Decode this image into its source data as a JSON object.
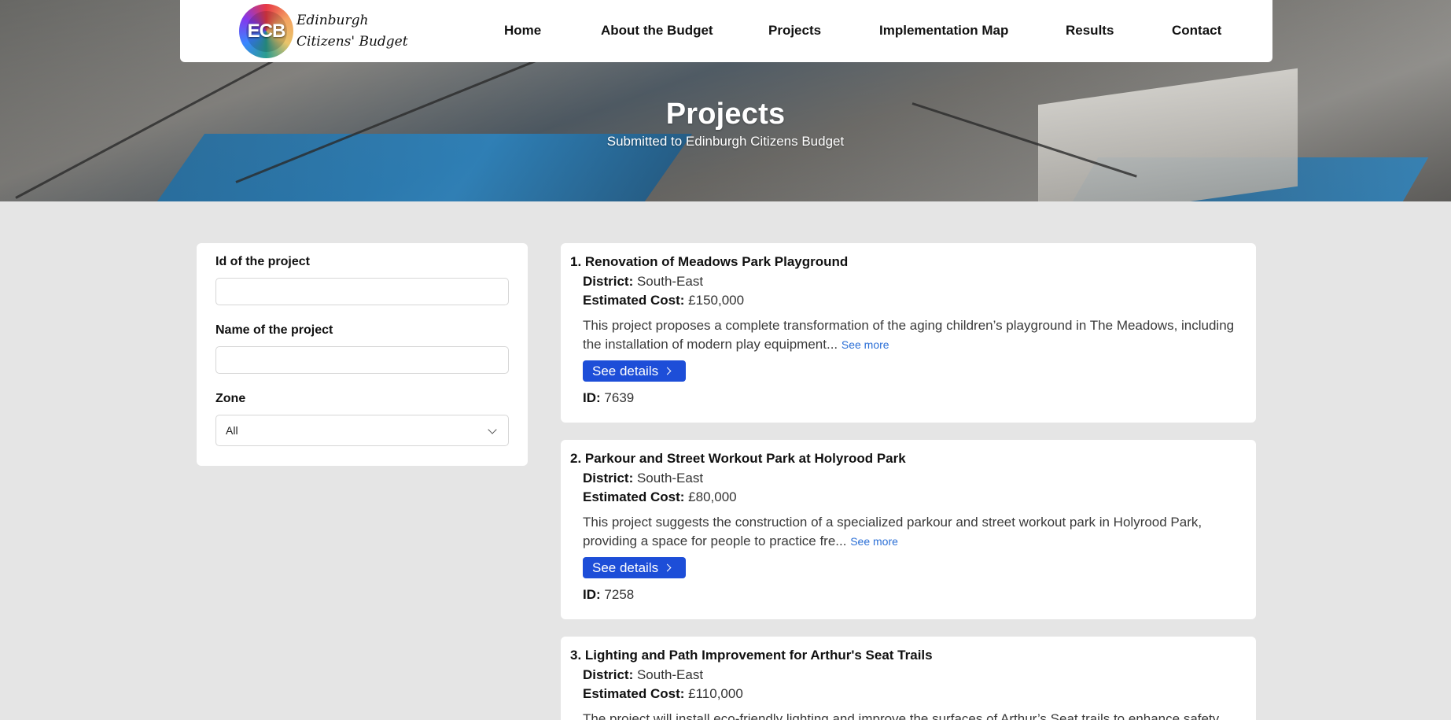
{
  "logo": {
    "initials": "ECB",
    "line1": "Edinburgh",
    "line2": "Citizens' Budget"
  },
  "nav": {
    "items": [
      "Home",
      "About the Budget",
      "Projects",
      "Implementation Map",
      "Results",
      "Contact"
    ]
  },
  "hero": {
    "title": "Projects",
    "subtitle": "Submitted to Edinburgh Citizens Budget"
  },
  "filters": {
    "id_label": "Id of the project",
    "id_value": "",
    "name_label": "Name of the project",
    "name_value": "",
    "zone_label": "Zone",
    "zone_selected": "All"
  },
  "projects": [
    {
      "title": "1. Renovation of Meadows Park Playground",
      "district_label": "District:",
      "district": "South-East",
      "cost_label": "Estimated Cost:",
      "cost": "£150,000",
      "description": "This project proposes a complete transformation of the aging children’s playground in The Meadows, including the installation of modern play equipment...",
      "see_more": "See more",
      "button": "See details",
      "id_label": "ID:",
      "id": "7639"
    },
    {
      "title": "2. Parkour and Street Workout Park at Holyrood Park",
      "district_label": "District:",
      "district": "South-East",
      "cost_label": "Estimated Cost:",
      "cost": "£80,000",
      "description": "This project suggests the construction of a specialized parkour and street workout park in Holyrood Park, providing a space for people to practice fre...",
      "see_more": "See more",
      "button": "See details",
      "id_label": "ID:",
      "id": "7258"
    },
    {
      "title": "3. Lighting and Path Improvement for Arthur's Seat Trails",
      "district_label": "District:",
      "district": "South-East",
      "cost_label": "Estimated Cost:",
      "cost": "£110,000",
      "description": "The project will install eco-friendly lighting and improve the surfaces of Arthur’s Seat trails to enhance safety"
    }
  ]
}
